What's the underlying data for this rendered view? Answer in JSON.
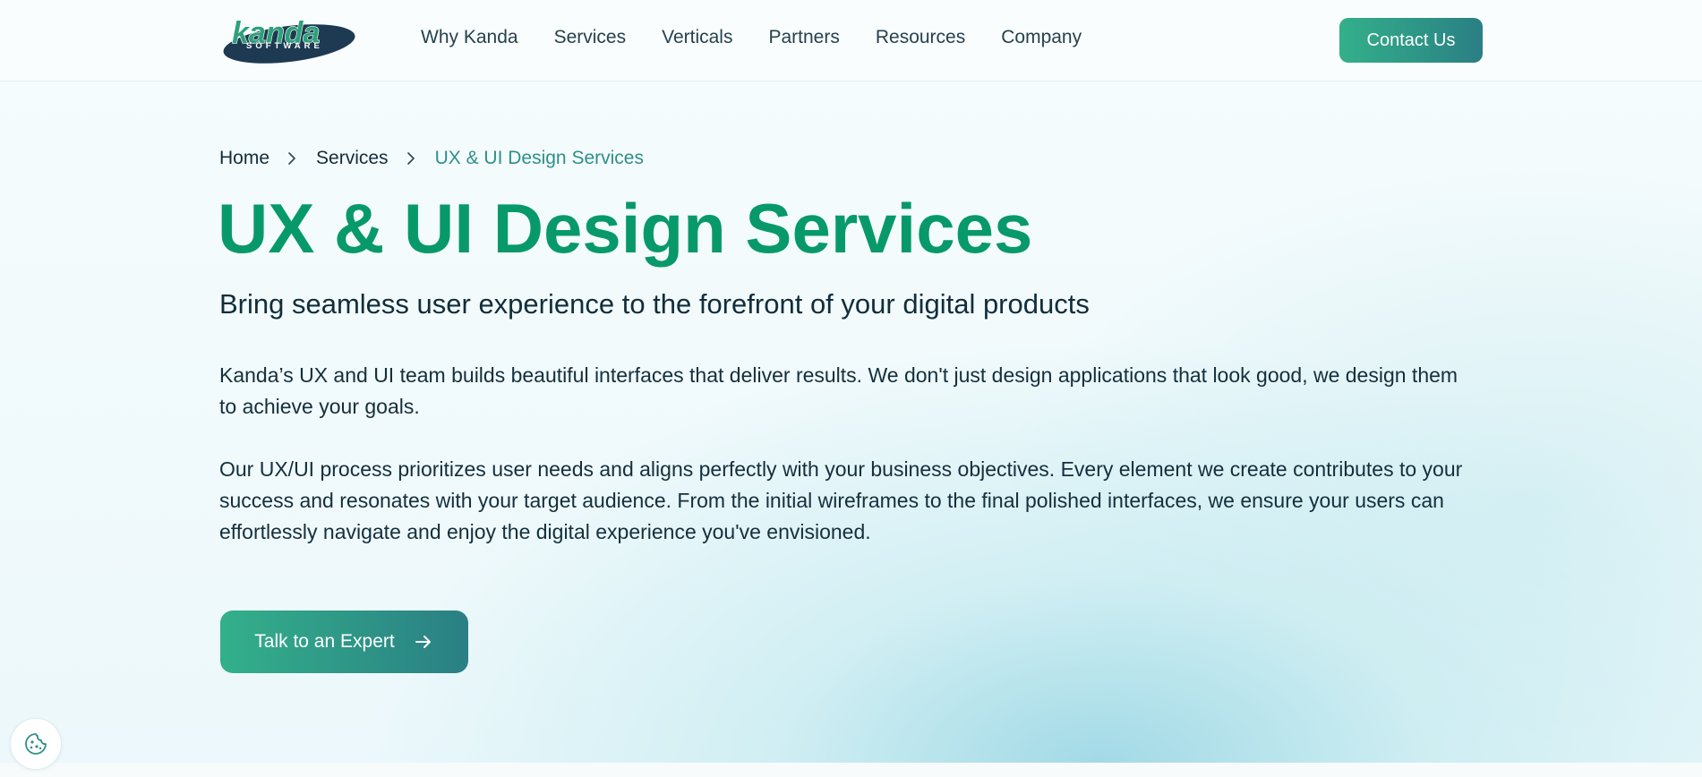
{
  "header": {
    "logo": {
      "wordmark": "kanda",
      "tagline": "SOFTWARE"
    },
    "nav": [
      {
        "label": "Why Kanda"
      },
      {
        "label": "Services"
      },
      {
        "label": "Verticals"
      },
      {
        "label": "Partners"
      },
      {
        "label": "Resources"
      },
      {
        "label": "Company"
      }
    ],
    "contact_label": "Contact Us"
  },
  "breadcrumb": {
    "items": [
      "Home",
      "Services",
      "UX & UI Design Services"
    ]
  },
  "hero": {
    "title": "UX & UI Design Services",
    "subtitle": "Bring seamless user experience to the forefront of your digital products",
    "paragraphs": [
      "Kanda’s UX and UI team builds beautiful interfaces that deliver results. We don't just design applications that look good, we design them to achieve your goals.",
      "Our UX/UI process prioritizes user needs and aligns perfectly with your business objectives. Every element we create contributes to your success and resonates with your target audience. From the initial wireframes to the final polished interfaces, we ensure your users can effortlessly navigate and enjoy the digital experience you've envisioned."
    ],
    "cta_label": "Talk to an Expert"
  },
  "icons": {
    "breadcrumb_separator": "chevron-right-icon",
    "cta": "arrow-right-icon",
    "cookie": "cookie-icon"
  },
  "colors": {
    "brand_green": "#07996a",
    "button_gradient_start": "#33b08a",
    "button_gradient_end": "#2a7f84",
    "logo_navy": "#1d3a52",
    "text_dark": "#152f3c"
  }
}
